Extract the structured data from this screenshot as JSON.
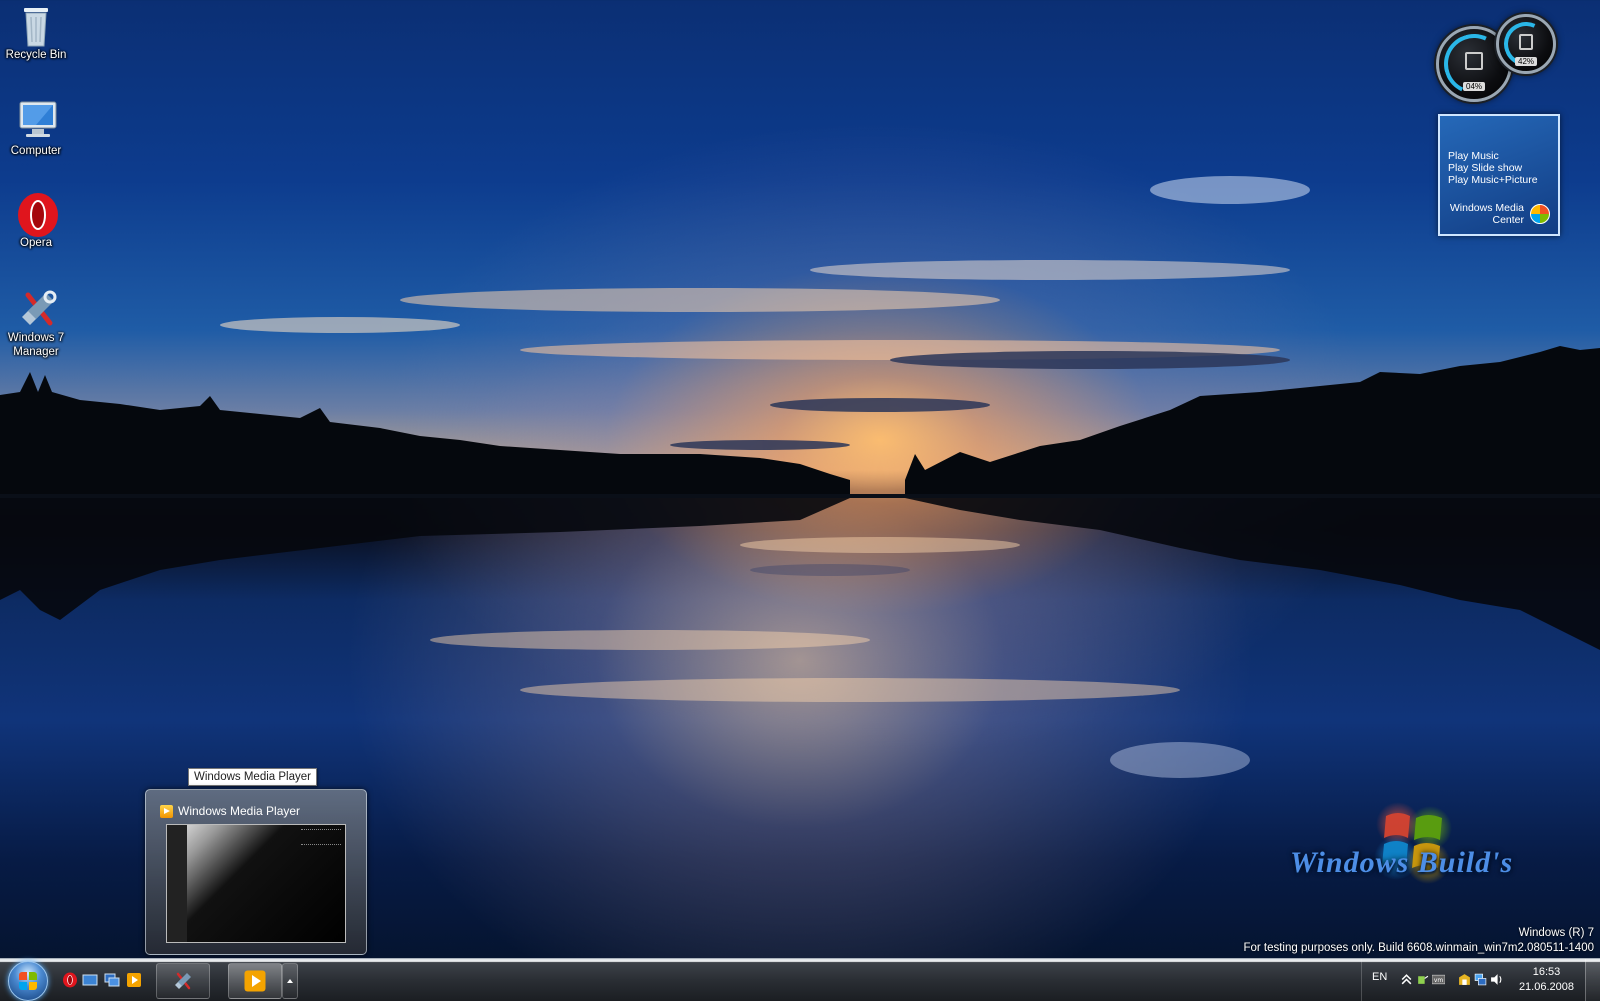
{
  "desktop": {
    "icons": [
      {
        "label": "Recycle Bin"
      },
      {
        "label": "Computer"
      },
      {
        "label": "Opera"
      },
      {
        "label": "Windows 7 Manager"
      }
    ]
  },
  "gadgets": {
    "cpu_meter": {
      "cpu_percent": "04%",
      "memory_percent": "42%"
    },
    "media_center": {
      "links": [
        "Play Music",
        "Play Slide show",
        "Play Music+Picture"
      ],
      "brand": "Windows Media Center"
    }
  },
  "watermark": {
    "text": "Windows Build's",
    "build_line1": "Windows (R) 7",
    "build_line2": "For testing purposes only. Build 6608.winmain_win7m2.080511-1400"
  },
  "preview": {
    "tooltip": "Windows Media Player",
    "title": "Windows Media Player"
  },
  "taskbar": {
    "language": "EN",
    "time": "16:53",
    "date": "21.06.2008"
  },
  "colors": {
    "accent_blue": "#2ab7e8",
    "watermark_blue": "#4d8ee6",
    "gadget_bg": "#1e5aa0"
  }
}
